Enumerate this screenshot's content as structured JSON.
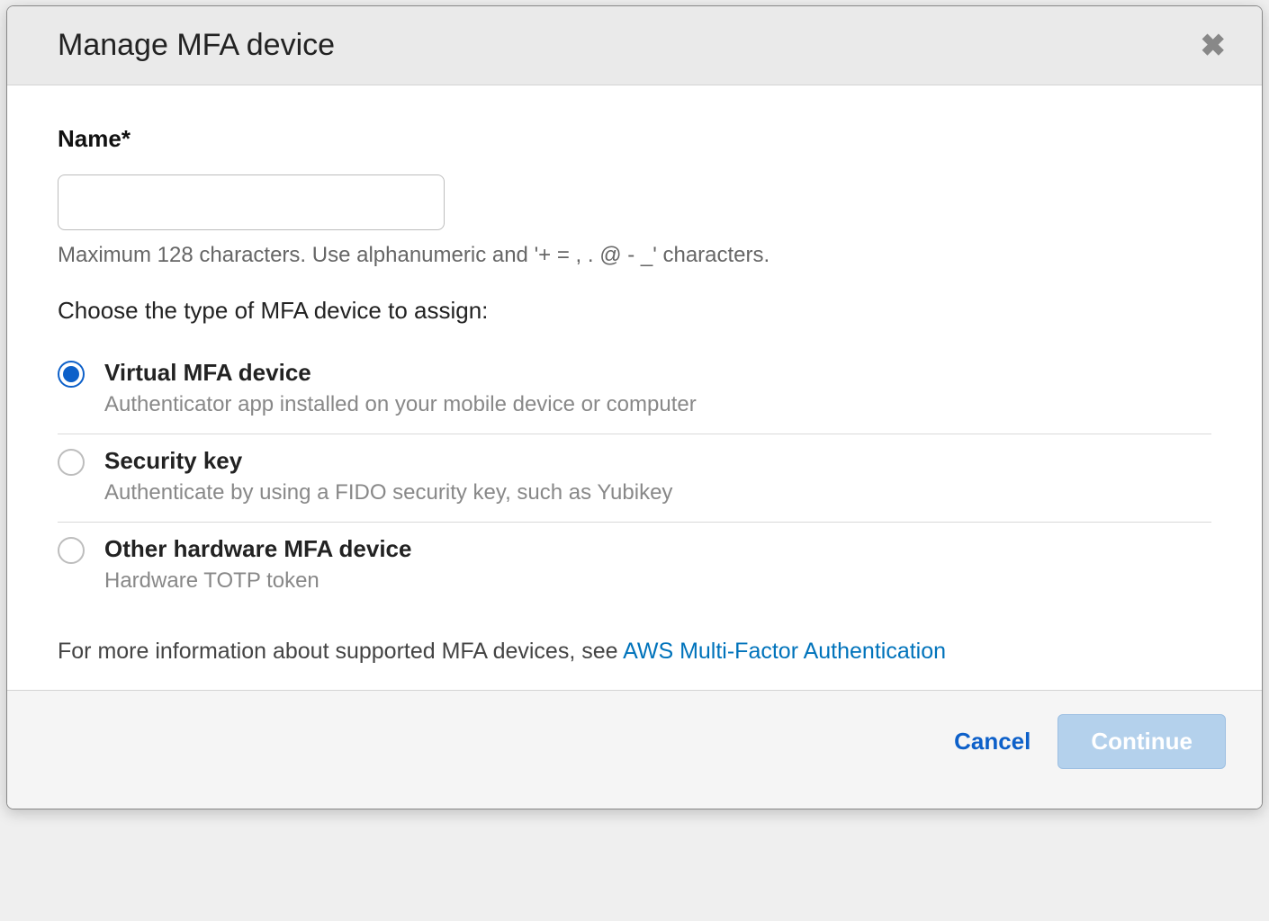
{
  "modal": {
    "title": "Manage MFA device",
    "name_label": "Name*",
    "name_value": "",
    "name_help": "Maximum 128 characters. Use alphanumeric and '+ = , . @ - _' characters.",
    "type_label": "Choose the type of MFA device to assign:",
    "options": [
      {
        "title": "Virtual MFA device",
        "desc": "Authenticator app installed on your mobile device or computer",
        "selected": true
      },
      {
        "title": "Security key",
        "desc": "Authenticate by using a FIDO security key, such as Yubikey",
        "selected": false
      },
      {
        "title": "Other hardware MFA device",
        "desc": "Hardware TOTP token",
        "selected": false
      }
    ],
    "info_prefix": "For more information about supported MFA devices, see ",
    "info_link": "AWS Multi-Factor Authentication",
    "cancel": "Cancel",
    "continue": "Continue"
  }
}
